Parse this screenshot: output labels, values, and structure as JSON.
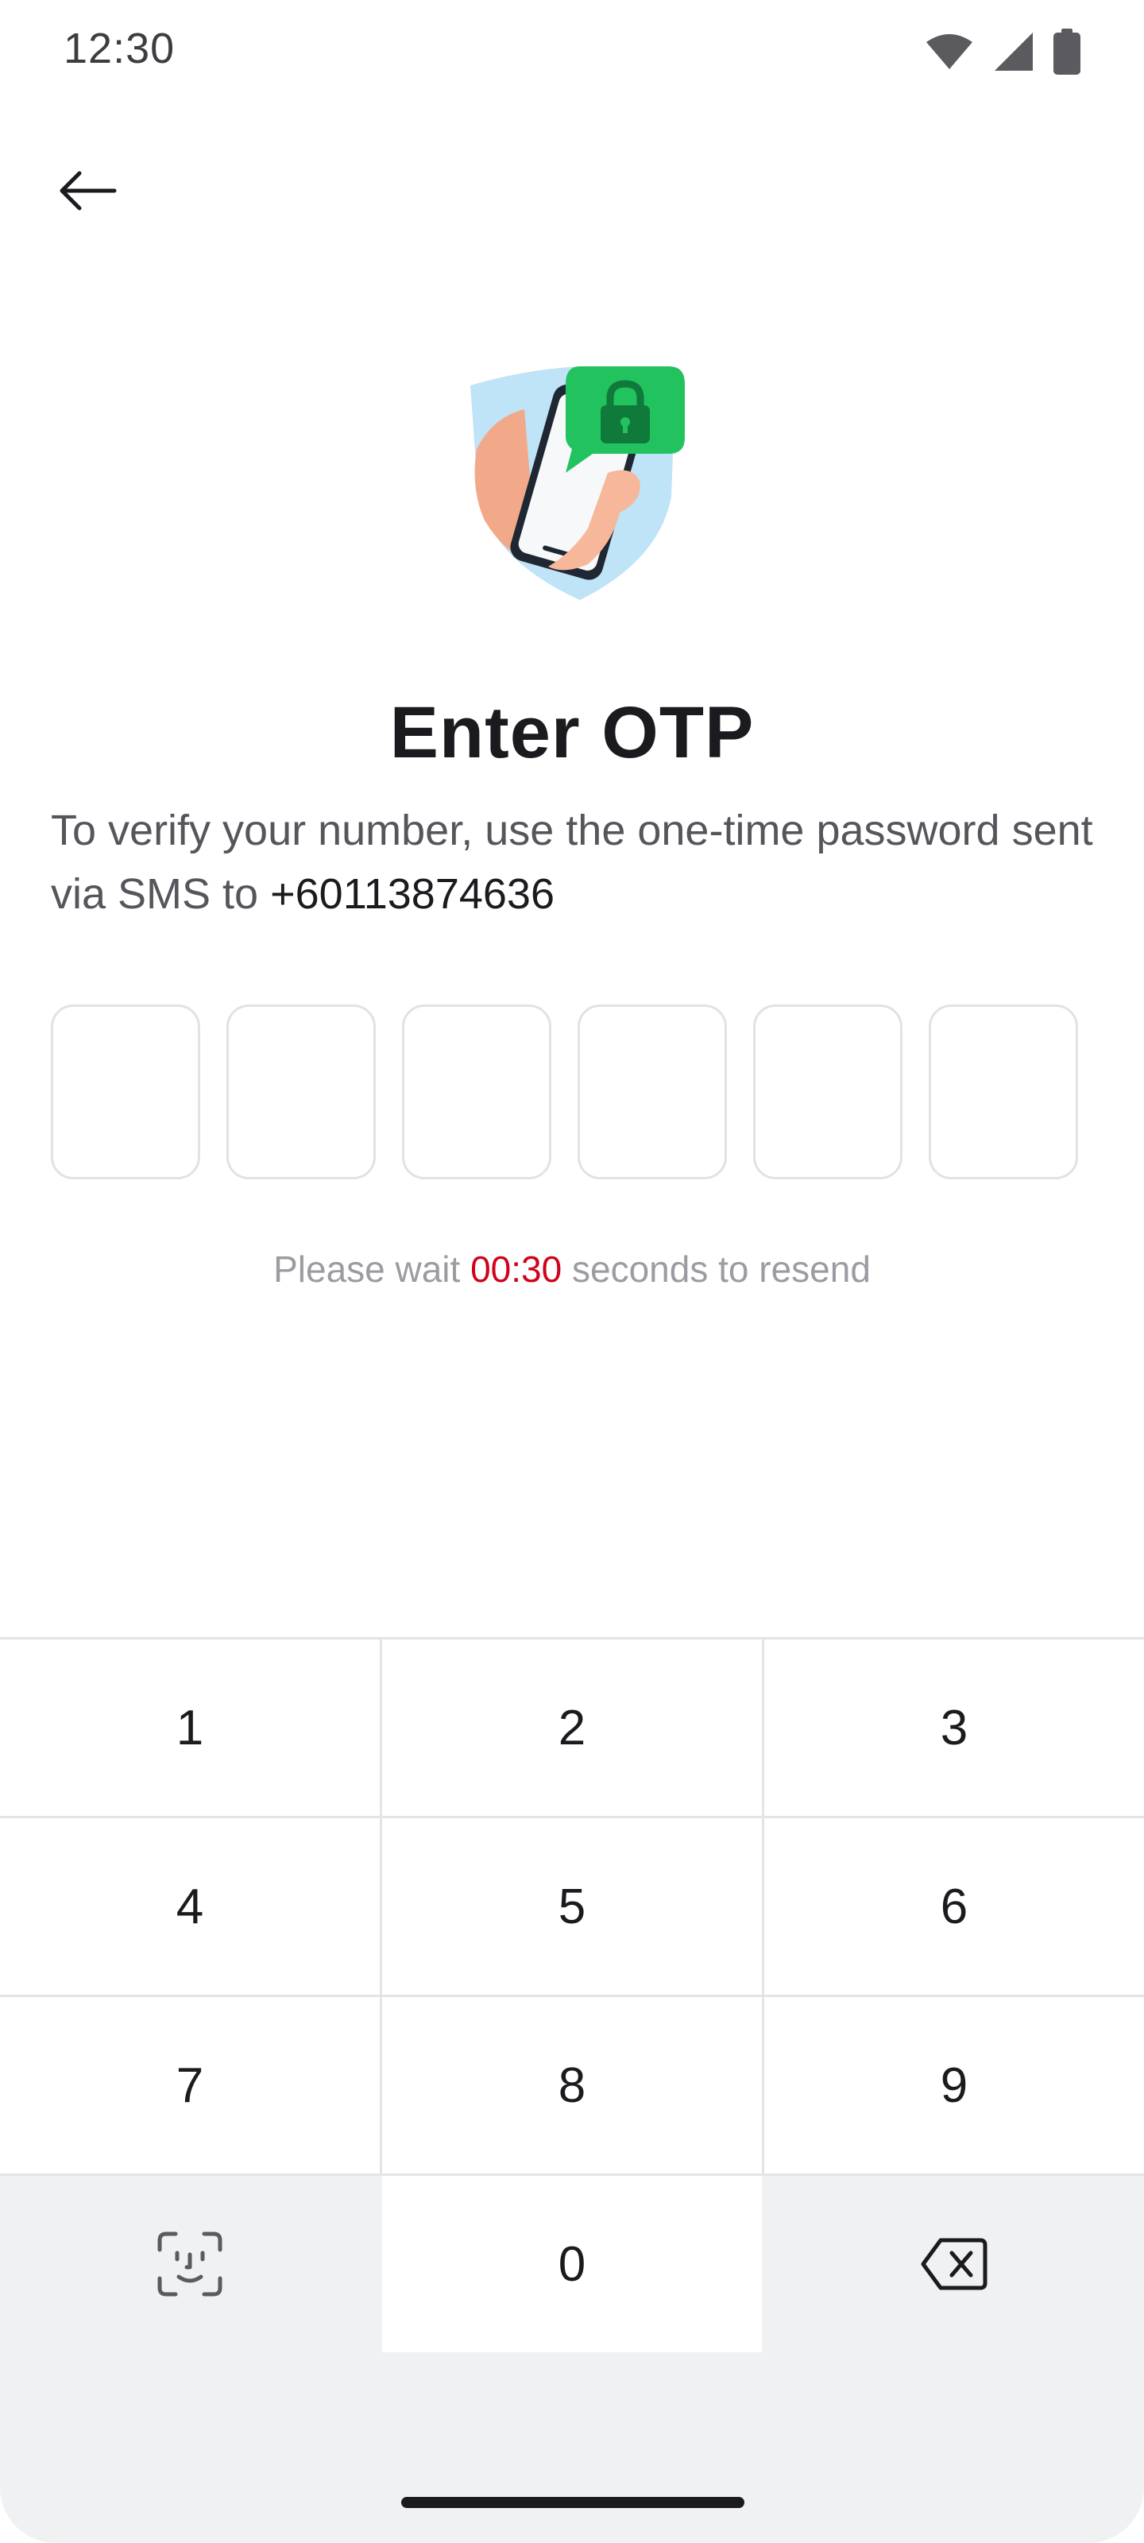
{
  "status_bar": {
    "time": "12:30",
    "icons": [
      "wifi-icon",
      "signal-icon",
      "battery-icon"
    ]
  },
  "header": {
    "back_icon": "arrow-left-icon"
  },
  "illustration": {
    "name": "phone-lock-shield-illustration",
    "colors": {
      "shield": "#bfe3f7",
      "bubble": "#22c35e",
      "lock": "#0f7a3a"
    }
  },
  "content": {
    "title": "Enter OTP",
    "description_prefix": "To verify your number, use the one-time password sent via SMS to ",
    "phone_number": "+60113874636"
  },
  "otp": {
    "digits": [
      "",
      "",
      "",
      "",
      "",
      ""
    ]
  },
  "resend": {
    "prefix": "Please wait ",
    "timer": "00:30",
    "suffix": " seconds to resend",
    "timer_color": "#d0021b"
  },
  "keypad": {
    "keys": [
      "1",
      "2",
      "3",
      "4",
      "5",
      "6",
      "7",
      "8",
      "9",
      "0"
    ],
    "left_action_icon": "face-scan-icon",
    "right_action_icon": "backspace-icon"
  }
}
